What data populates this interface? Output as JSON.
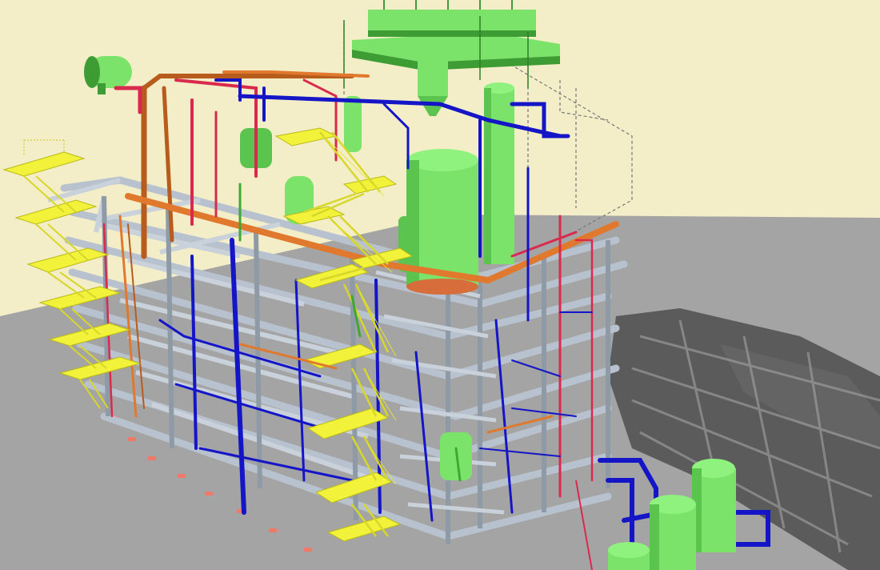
{
  "scene": {
    "kind": "3d-plant-model-render",
    "colors": {
      "sky": "#f3eec8",
      "ground": "#a4a4a4",
      "shadow": "#4f4f4f",
      "steel": "#b7c2ce",
      "steel_dark": "#8e9aa6",
      "equipment": "#7ce36a",
      "equipment_dark": "#3e9c34",
      "stairs": "#f2f23a",
      "stairs_dark": "#b9b918",
      "pipe_blue": "#1515c8",
      "pipe_red": "#d92a4e",
      "pipe_orange": "#e0792e",
      "pipe_brown": "#b85c1e",
      "grey_pipe": "#c9d1da",
      "markers": "#f07a6a"
    }
  }
}
